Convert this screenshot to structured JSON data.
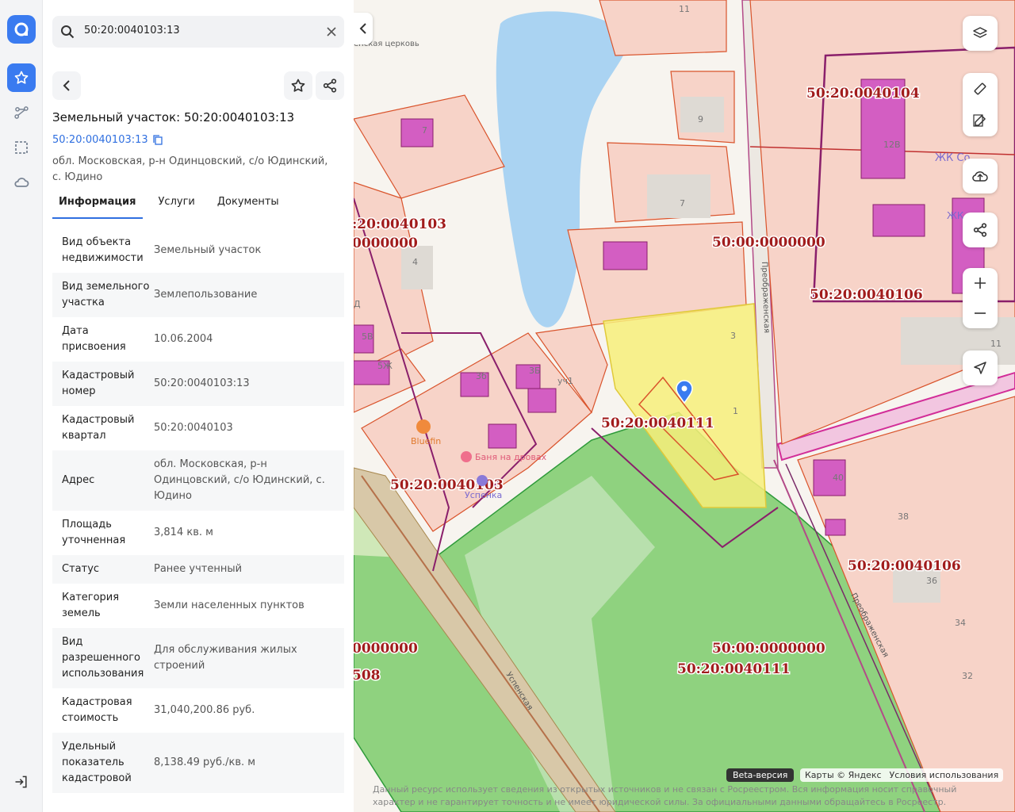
{
  "search": {
    "value": "50:20:0040103:13"
  },
  "parcel": {
    "title": "Земельный участок: 50:20:0040103:13",
    "cadastral_link": "50:20:0040103:13",
    "address": "обл. Московская, р-н Одинцовский, с/о Юдинский, с. Юдино"
  },
  "tabs": [
    "Информация",
    "Услуги",
    "Документы"
  ],
  "info": [
    {
      "label": "Вид объекта недвижимости",
      "value": "Земельный участок"
    },
    {
      "label": "Вид земельного участка",
      "value": "Землепользование"
    },
    {
      "label": "Дата присвоения",
      "value": "10.06.2004"
    },
    {
      "label": "Кадастровый номер",
      "value": "50:20:0040103:13"
    },
    {
      "label": "Кадастровый квартал",
      "value": "50:20:0040103"
    },
    {
      "label": "Адрес",
      "value": "обл. Московская, р-н Одинцовский, с/о Юдинский, с. Юдино"
    },
    {
      "label": "Площадь уточненная",
      "value": "3,814 кв. м"
    },
    {
      "label": "Статус",
      "value": "Ранее учтенный"
    },
    {
      "label": "Категория земель",
      "value": "Земли населенных пунктов"
    },
    {
      "label": "Вид разрешенного использования",
      "value": "Для обслуживания жилых строений"
    },
    {
      "label": "Кадастровая стоимость",
      "value": "31,040,200.86 руб."
    },
    {
      "label": "Удельный показатель кадастровой",
      "value": "8,138.49 руб./кв. м"
    }
  ],
  "map": {
    "labels": {
      "q0111a": "50:20:0040111",
      "q0111b": "50:20:0040111",
      "q0000a": "50:00:0000000",
      "q0000b": "50:00:0000000",
      "q0104": "50:20:0040104",
      "q0106a": "50:20:0040106",
      "q0106b": "50:20:0040106",
      "q0103a": "50:20:0040103",
      "q0103b": ":20:0040103",
      "q0000c": "0000000",
      "q0000d": "0000000",
      "q508": "508"
    },
    "places": {
      "bluefin": "Bluefin",
      "banya": "Баня на дровах",
      "uspenka": "Успенка",
      "zhk1": "ЖК Со",
      "zhk2": "ЖК",
      "church": "енская церковь"
    },
    "streets": {
      "s1": "Преображенская",
      "s2": "Преображенская",
      "s3": "Успенская"
    },
    "houses": [
      "11",
      "9",
      "7",
      "7",
      "4",
      "3",
      "1",
      "3б",
      "3Б",
      "уч1",
      "40",
      "38",
      "36",
      "34",
      "32",
      "11",
      "12В",
      "5В",
      "5Ж",
      "Д"
    ]
  },
  "footer": {
    "beta": "Beta-версия",
    "maps": "Карты © Яндекс",
    "terms": "Условия использования",
    "disclaimer": "Данный ресурс использует сведения из открытых источников и не связан с Росреестром. Вся информация носит справочный характер и не гарантирует точность и не имеет юридической силы. За официальными данными обращайтесь в Росреестр."
  },
  "colors": {
    "accent": "#3a7bf0",
    "parcel_fill": "#f7d3c8",
    "parcel_stroke": "#d9532b",
    "quarter_stroke": "#8a1f6b",
    "selected": "#f7ef7a",
    "green": "#8fd27f",
    "water": "#aad3f2"
  }
}
